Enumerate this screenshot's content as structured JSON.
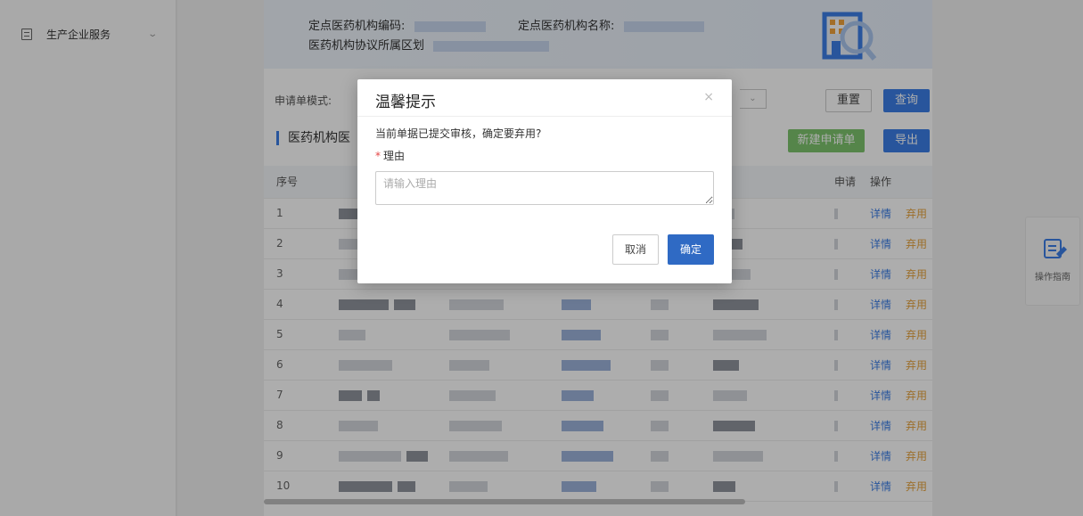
{
  "sidebar": {
    "items": [
      {
        "label": "生产企业服务",
        "icon": "document-icon"
      }
    ]
  },
  "banner": {
    "code_label": "定点医药机构编码:",
    "name_label": "定点医药机构名称:",
    "region_label": "医药机构协议所属区划"
  },
  "filter": {
    "mode_label": "申请单模式:",
    "reset_label": "重置",
    "query_label": "查询"
  },
  "section": {
    "title": "医药机构医",
    "new_label": "新建申请单",
    "export_label": "导出"
  },
  "table": {
    "headers": {
      "index": "序号",
      "apply": "申请",
      "ops": "操作"
    },
    "rows": [
      "1",
      "2",
      "3",
      "4",
      "5",
      "6",
      "7",
      "8",
      "9",
      "10"
    ],
    "detail_label": "详情",
    "discard_label": "弃用"
  },
  "guide": {
    "label": "操作指南"
  },
  "modal": {
    "title": "温馨提示",
    "close_glyph": "×",
    "message": "当前单据已提交审核，确定要弃用?",
    "required_mark": "*",
    "field_label": "理由",
    "placeholder": "请输入理由",
    "cancel_label": "取消",
    "confirm_label": "确定"
  },
  "colors": {
    "primary": "#3c7ee6",
    "confirm": "#2f6ac4",
    "discard": "#e6a23c",
    "new": "#7ec46e",
    "required": "#e54545"
  }
}
